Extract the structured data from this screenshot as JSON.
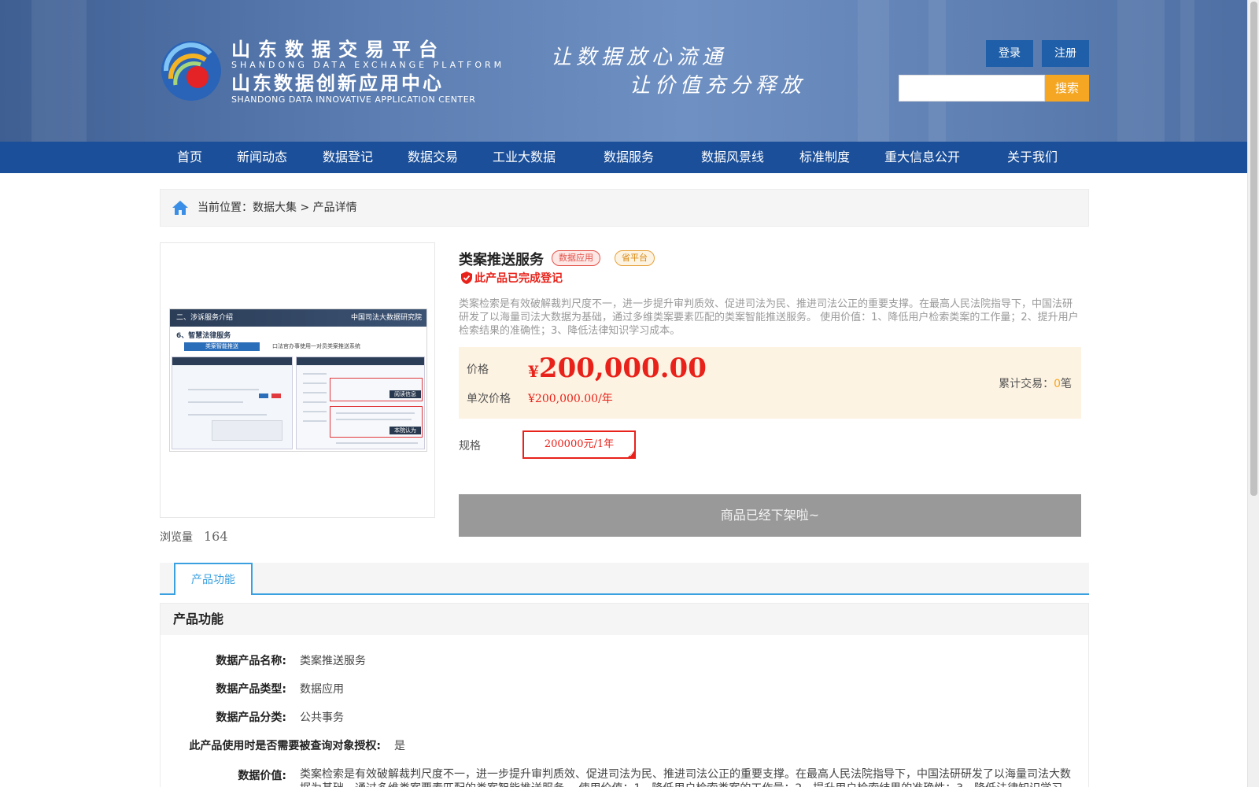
{
  "header": {
    "brand": {
      "cn1": "山东数据交易平台",
      "en1": "SHANDONG DATA EXCHANGE PLATFORM",
      "cn2": "山东数据创新应用中心",
      "en2": "SHANDONG DATA INNOVATIVE APPLICATION CENTER"
    },
    "slogan_line1": "让数据放心流通",
    "slogan_line2": "让价值充分释放",
    "login_label": "登录",
    "register_label": "注册",
    "search_value": "",
    "search_label": "搜索"
  },
  "nav": {
    "items": [
      "首页",
      "新闻动态",
      "数据登记",
      "数据交易",
      "工业大数据",
      "数据服务",
      "数据风景线",
      "标准制度",
      "重大信息公开",
      "关于我们"
    ]
  },
  "breadcrumb": {
    "prefix": "当前位置：",
    "path": "数据大集",
    "sep": " > ",
    "current": "产品详情"
  },
  "product": {
    "views_label": "浏览量",
    "views": "164",
    "title": "类案推送服务",
    "badge_type": "数据应用",
    "badge_platform": "省平台",
    "registered": "此产品已完成登记",
    "description": "类案检索是有效破解裁判尺度不一，进一步提升审判质效、促进司法为民、推进司法公正的重要支撑。在最高人民法院指导下，中国法研研发了以海量司法大数据为基础，通过多维类案要素匹配的类案智能推送服务。 使用价值：1、降低用户检索类案的工作量；2、提升用户检索结果的准确性；3、降低法律知识学习成本。",
    "price_label": "价格",
    "price_currency": "¥",
    "price": "200,000.00",
    "single_label": "单次价格",
    "single_price": "¥200,000.00/年",
    "total_label": "累计交易：",
    "total_count": "0",
    "total_unit": "笔",
    "spec_label": "规格",
    "spec_option": "200000元/1年",
    "offshelf": "商品已经下架啦~"
  },
  "screenshot_texts": {
    "bar": "二、涉诉服务介绍",
    "org": "中国司法大数据研究院",
    "sub": "6、智慧法律服务",
    "tab": "类案智能推送",
    "note": "口法官办事使用一对员类案推送系统",
    "lbl1": "阅读信息",
    "lbl2": "本院认为"
  },
  "tabs": [
    "产品功能"
  ],
  "section": {
    "title": "产品功能",
    "rows": [
      {
        "k": "数据产品名称:",
        "v": "类案推送服务"
      },
      {
        "k": "数据产品类型:",
        "v": "数据应用"
      },
      {
        "k": "数据产品分类:",
        "v": "公共事务"
      },
      {
        "k": "此产品使用时是否需要被查询对象授权:",
        "v": "是"
      },
      {
        "k": "数据价值:",
        "v": "类案检索是有效破解裁判尺度不一，进一步提升审判质效、促进司法为民、推进司法公正的重要支撑。在最高人民法院指导下，中国法研研发了以海量司法大数据为基础，通过多维类案要素匹配的类案智能推送服务。 使用价值：1、降低用户检索类案的工作量；2、提升用户检索结果的准确性；3、降低法律知识学习成本。"
      }
    ]
  },
  "colors": {
    "nav_bg": "#1b4f99",
    "accent_red": "#e8221a",
    "accent_orange": "#f5a623",
    "tab_blue": "#3aa0e0"
  }
}
